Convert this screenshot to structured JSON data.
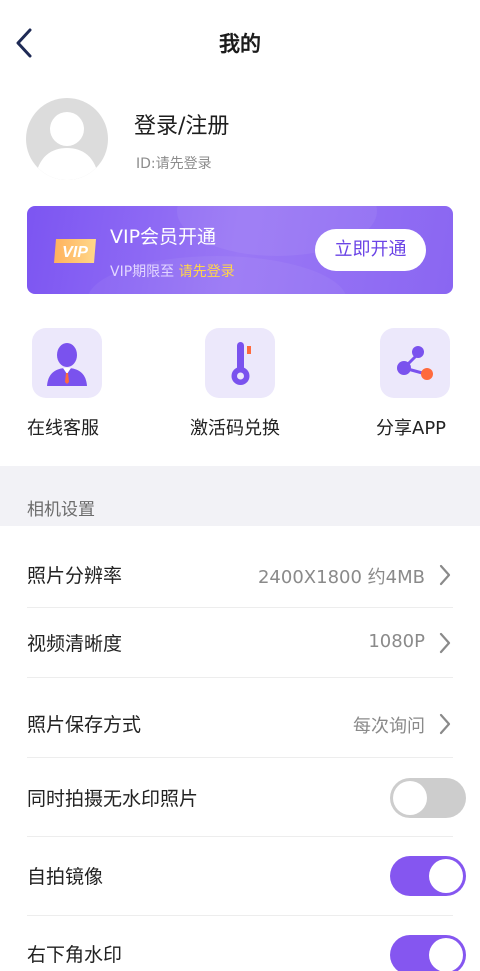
{
  "header": {
    "title": "我的",
    "back_icon": "chevron-left-icon"
  },
  "profile": {
    "login_title": "登录/注册",
    "user_id": "ID:请先登录",
    "avatar_icon": "default-avatar-icon"
  },
  "vip": {
    "badge": "VIP",
    "title": "VIP会员开通",
    "expiry_prefix": "VIP期限至 ",
    "expiry_value": "请先登录",
    "button": "立即开通"
  },
  "shortcuts": [
    {
      "label": "在线客服",
      "icon": "customer-service-icon"
    },
    {
      "label": "激活码兑换",
      "icon": "thermometer-key-icon"
    },
    {
      "label": "分享APP",
      "icon": "share-icon"
    }
  ],
  "camera_settings": {
    "section_title": "相机设置",
    "resolution": {
      "label": "照片分辨率",
      "value": "2400X1800 约4MB"
    },
    "video_quality": {
      "label": "视频清晰度",
      "value": "1080P"
    },
    "save_mode": {
      "label": "照片保存方式",
      "value": "每次询问"
    },
    "no_watermark_copy": {
      "label": "同时拍摄无水印照片",
      "enabled": false
    },
    "selfie_mirror": {
      "label": "自拍镜像",
      "enabled": true
    },
    "corner_watermark": {
      "label": "右下角水印",
      "enabled": true
    }
  },
  "colors": {
    "accent": "#8556f0",
    "vip_gold": "#ffd54a",
    "toggle_off": "#cdcdcd"
  }
}
